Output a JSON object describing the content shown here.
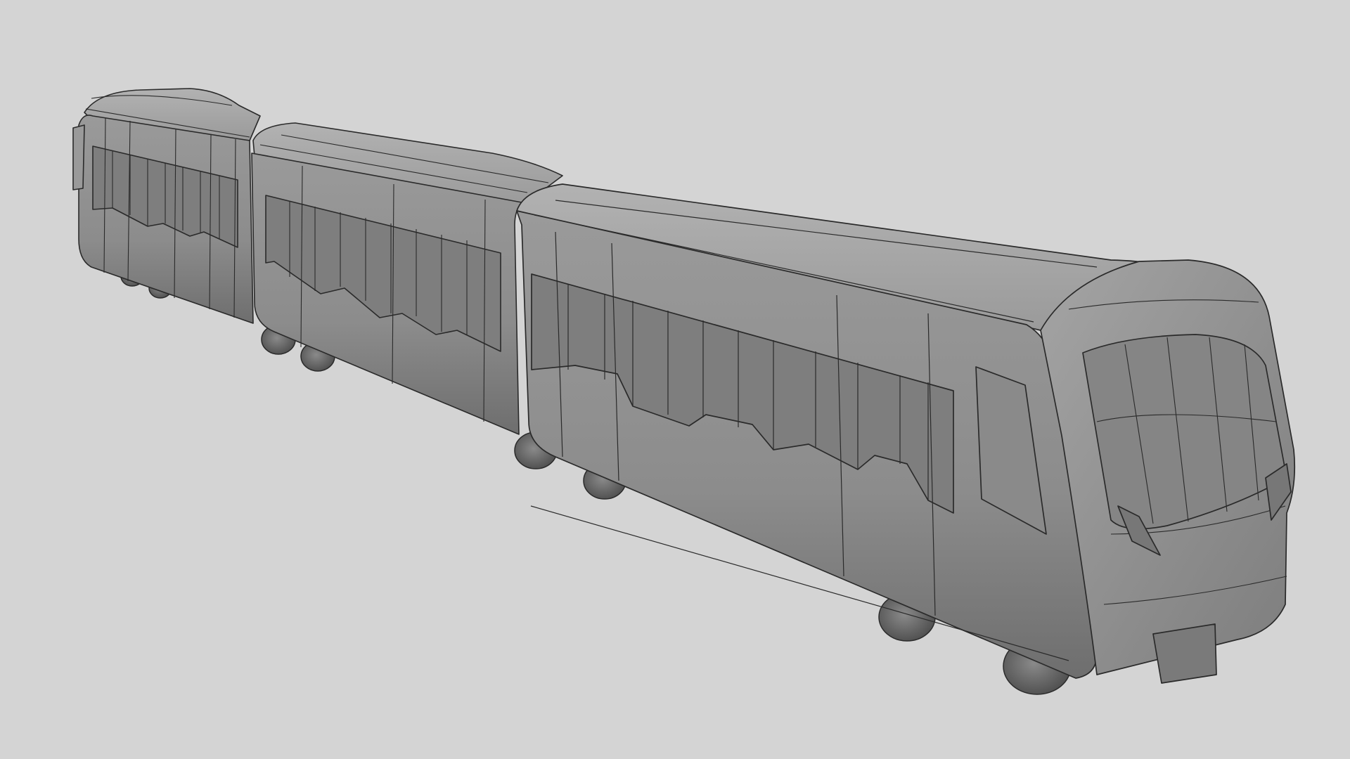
{
  "viewport": {
    "background_color": "#d4d4d4",
    "display_mode": "wireframe-on-shaded"
  },
  "model": {
    "subject": "three-car train",
    "car_count": 3,
    "colors": {
      "body_side": "#8f8f8f",
      "body_roof": "#a7a7a7",
      "body_dark": "#6f6f6f",
      "wireframe": "#2a2a2a",
      "wheel": "#5c5c5c"
    }
  }
}
